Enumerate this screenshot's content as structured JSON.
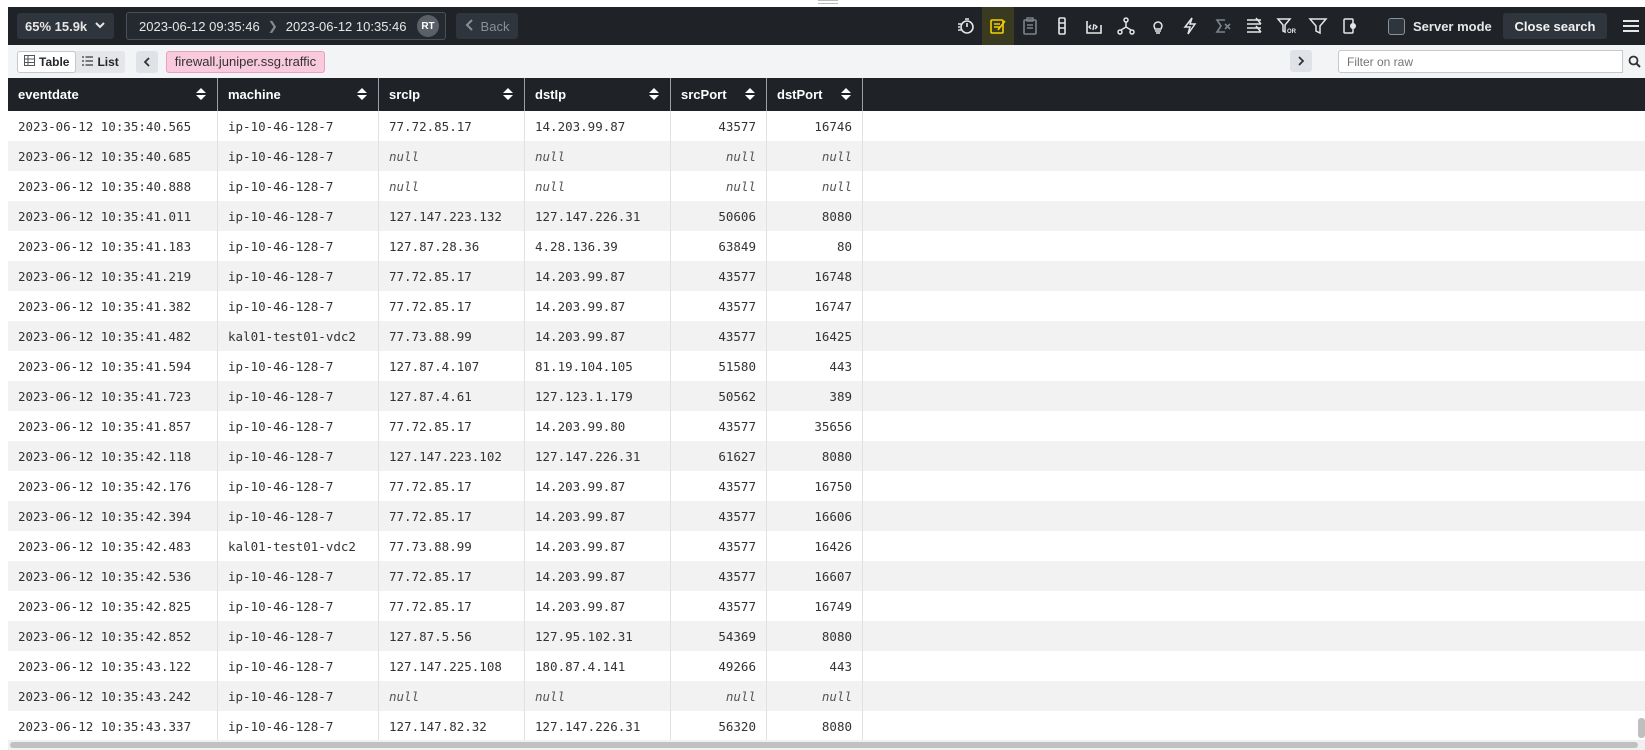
{
  "toolbar": {
    "zoom_label": "65% 15.9k",
    "range_start": "2023-06-12 09:35:46",
    "range_end": "2023-06-12 10:35:46",
    "rt_badge": "RT",
    "back_label": "Back",
    "icons": [
      "stopwatch-icon",
      "highlight-icon",
      "clipboard-icon",
      "columns-icon",
      "code-icon",
      "network-icon",
      "lightbulb-icon",
      "lightning-icon",
      "clear-formula-icon",
      "stacked-lines-icon",
      "filter-or-icon",
      "filter-icon",
      "export-icon"
    ],
    "active_icon_color": "#f5d000",
    "server_mode_label": "Server mode",
    "close_search_label": "Close search"
  },
  "view": {
    "table_label": "Table",
    "list_label": "List",
    "tag": "firewall.juniper.ssg.traffic",
    "filter_placeholder": "Filter on raw"
  },
  "table": {
    "columns": [
      "eventdate",
      "machine",
      "srcIp",
      "dstIp",
      "srcPort",
      "dstPort"
    ],
    "rows": [
      [
        "2023-06-12 10:35:40.565",
        "ip-10-46-128-7",
        "77.72.85.17",
        "14.203.99.87",
        "43577",
        "16746"
      ],
      [
        "2023-06-12 10:35:40.685",
        "ip-10-46-128-7",
        "null",
        "null",
        "null",
        "null"
      ],
      [
        "2023-06-12 10:35:40.888",
        "ip-10-46-128-7",
        "null",
        "null",
        "null",
        "null"
      ],
      [
        "2023-06-12 10:35:41.011",
        "ip-10-46-128-7",
        "127.147.223.132",
        "127.147.226.31",
        "50606",
        "8080"
      ],
      [
        "2023-06-12 10:35:41.183",
        "ip-10-46-128-7",
        "127.87.28.36",
        "4.28.136.39",
        "63849",
        "80"
      ],
      [
        "2023-06-12 10:35:41.219",
        "ip-10-46-128-7",
        "77.72.85.17",
        "14.203.99.87",
        "43577",
        "16748"
      ],
      [
        "2023-06-12 10:35:41.382",
        "ip-10-46-128-7",
        "77.72.85.17",
        "14.203.99.87",
        "43577",
        "16747"
      ],
      [
        "2023-06-12 10:35:41.482",
        "kal01-test01-vdc2",
        "77.73.88.99",
        "14.203.99.87",
        "43577",
        "16425"
      ],
      [
        "2023-06-12 10:35:41.594",
        "ip-10-46-128-7",
        "127.87.4.107",
        "81.19.104.105",
        "51580",
        "443"
      ],
      [
        "2023-06-12 10:35:41.723",
        "ip-10-46-128-7",
        "127.87.4.61",
        "127.123.1.179",
        "50562",
        "389"
      ],
      [
        "2023-06-12 10:35:41.857",
        "ip-10-46-128-7",
        "77.72.85.17",
        "14.203.99.80",
        "43577",
        "35656"
      ],
      [
        "2023-06-12 10:35:42.118",
        "ip-10-46-128-7",
        "127.147.223.102",
        "127.147.226.31",
        "61627",
        "8080"
      ],
      [
        "2023-06-12 10:35:42.176",
        "ip-10-46-128-7",
        "77.72.85.17",
        "14.203.99.87",
        "43577",
        "16750"
      ],
      [
        "2023-06-12 10:35:42.394",
        "ip-10-46-128-7",
        "77.72.85.17",
        "14.203.99.87",
        "43577",
        "16606"
      ],
      [
        "2023-06-12 10:35:42.483",
        "kal01-test01-vdc2",
        "77.73.88.99",
        "14.203.99.87",
        "43577",
        "16426"
      ],
      [
        "2023-06-12 10:35:42.536",
        "ip-10-46-128-7",
        "77.72.85.17",
        "14.203.99.87",
        "43577",
        "16607"
      ],
      [
        "2023-06-12 10:35:42.825",
        "ip-10-46-128-7",
        "77.72.85.17",
        "14.203.99.87",
        "43577",
        "16749"
      ],
      [
        "2023-06-12 10:35:42.852",
        "ip-10-46-128-7",
        "127.87.5.56",
        "127.95.102.31",
        "54369",
        "8080"
      ],
      [
        "2023-06-12 10:35:43.122",
        "ip-10-46-128-7",
        "127.147.225.108",
        "180.87.4.141",
        "49266",
        "443"
      ],
      [
        "2023-06-12 10:35:43.242",
        "ip-10-46-128-7",
        "null",
        "null",
        "null",
        "null"
      ],
      [
        "2023-06-12 10:35:43.337",
        "ip-10-46-128-7",
        "127.147.82.32",
        "127.147.226.31",
        "56320",
        "8080"
      ]
    ]
  }
}
